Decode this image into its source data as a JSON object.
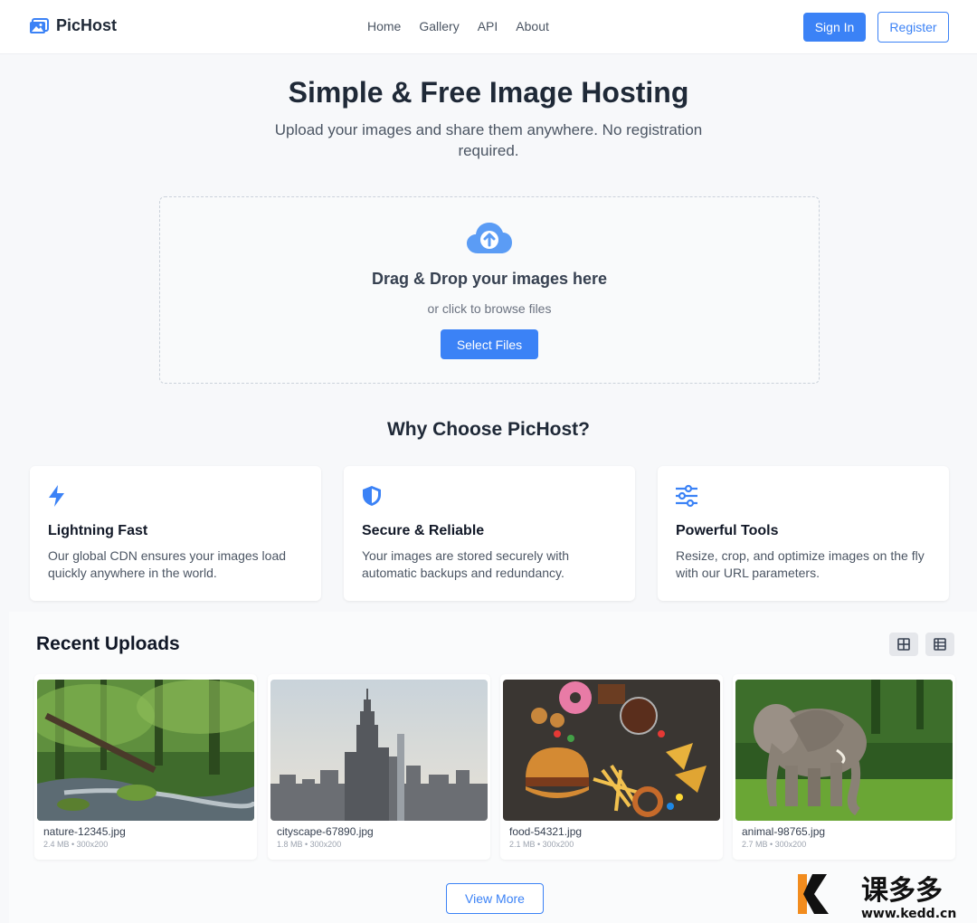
{
  "brand": {
    "name": "PicHost",
    "accent": "#3b82f6"
  },
  "nav": {
    "items": [
      "Home",
      "Gallery",
      "API",
      "About"
    ]
  },
  "auth": {
    "signin": "Sign In",
    "register": "Register"
  },
  "hero": {
    "title": "Simple & Free Image Hosting",
    "subtitle": "Upload your images and share them anywhere. No registration required."
  },
  "upload": {
    "title": "Drag & Drop your images here",
    "subtitle": "or click to browse files",
    "button": "Select Files",
    "icon": "cloud-upload-icon"
  },
  "features": {
    "heading": "Why Choose PicHost?",
    "items": [
      {
        "icon": "lightning-icon",
        "title": "Lightning Fast",
        "desc": "Our global CDN ensures your images load quickly anywhere in the world."
      },
      {
        "icon": "shield-icon",
        "title": "Secure & Reliable",
        "desc": "Your images are stored securely with automatic backups and redundancy."
      },
      {
        "icon": "sliders-icon",
        "title": "Powerful Tools",
        "desc": "Resize, crop, and optimize images on the fly with our URL parameters."
      }
    ]
  },
  "recent": {
    "heading": "Recent Uploads",
    "items": [
      {
        "name": "nature-12345.jpg",
        "meta": "2.4 MB • 300x200"
      },
      {
        "name": "cityscape-67890.jpg",
        "meta": "1.8 MB • 300x200"
      },
      {
        "name": "food-54321.jpg",
        "meta": "2.1 MB • 300x200"
      },
      {
        "name": "animal-98765.jpg",
        "meta": "2.7 MB • 300x200"
      }
    ],
    "view_more": "View More"
  },
  "watermark": {
    "text": "课多多",
    "url": "www.kedd.cn"
  }
}
